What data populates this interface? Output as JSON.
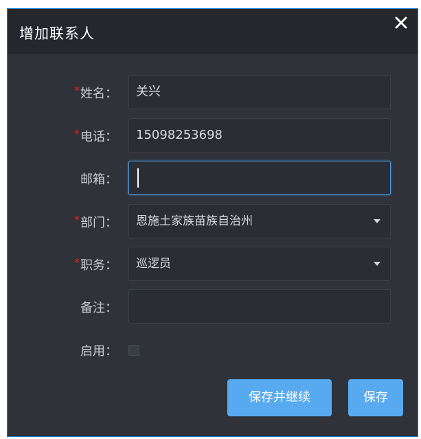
{
  "dialog": {
    "title": "增加联系人",
    "close_icon": "close-icon"
  },
  "form": {
    "required_mark": "*",
    "name": {
      "label": "姓名：",
      "required": true,
      "value": "关兴"
    },
    "phone": {
      "label": "电话：",
      "required": true,
      "value": "15098253698"
    },
    "email": {
      "label": "邮箱：",
      "required": false,
      "value": ""
    },
    "department": {
      "label": "部门：",
      "required": true,
      "value": "恩施土家族苗族自治州"
    },
    "position": {
      "label": "职务：",
      "required": true,
      "value": "巡逻员"
    },
    "note": {
      "label": "备注：",
      "required": false,
      "value": ""
    },
    "enabled": {
      "label": "启用：",
      "checked": false
    }
  },
  "buttons": {
    "save_continue": "保存并继续",
    "save": "保存"
  },
  "colors": {
    "accent": "#58aaf0",
    "required": "#d7262c",
    "panel": "#2f3238",
    "titlebar": "#25272d"
  }
}
